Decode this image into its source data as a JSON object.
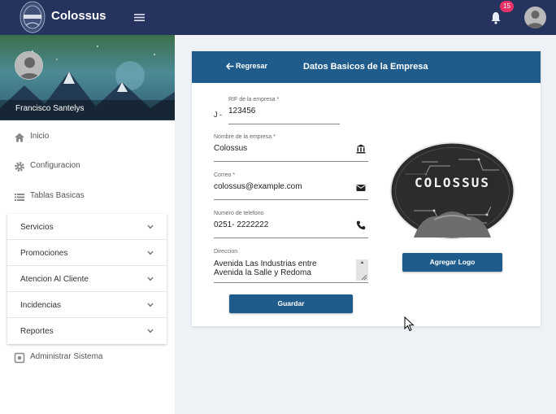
{
  "app": {
    "title": "Colossus",
    "notification_count": "15"
  },
  "sidebar": {
    "user_name": "Francisco Santelys",
    "nav": [
      {
        "label": "Inicio",
        "icon": "home-icon"
      },
      {
        "label": "Configuracion",
        "icon": "gear-icon"
      },
      {
        "label": "Tablas Basicas",
        "icon": "list-icon"
      }
    ],
    "submenu": [
      {
        "label": "Servicios"
      },
      {
        "label": "Promociones"
      },
      {
        "label": "Atencion Al Cliente"
      },
      {
        "label": "Incidencias"
      },
      {
        "label": "Reportes"
      }
    ],
    "admin": {
      "label": "Administrar Sistema",
      "icon": "admin-icon"
    }
  },
  "card": {
    "back_label": "Regresar",
    "title": "Datos Basicos de la Empresa",
    "rif": {
      "label": "RIF de la empresa *",
      "prefix": "J -",
      "value": "123456"
    },
    "name": {
      "label": "Nombre de la empresa *",
      "value": "Colossus"
    },
    "email": {
      "label": "Correo *",
      "value": "colossus@example.com"
    },
    "phone": {
      "label": "Numero de telefono",
      "value": "0251- 2222222"
    },
    "address": {
      "label": "Direccion",
      "line1": "Avenida Las Industrias entre",
      "line2": "Avenida la Salle y Redoma"
    },
    "save_label": "Guardar",
    "logo_text": "COLOSSUS",
    "add_logo_label": "Agregar Logo"
  },
  "colors": {
    "topbar": "#25335e",
    "primary": "#1f5c8c",
    "badge": "#e5336a"
  }
}
